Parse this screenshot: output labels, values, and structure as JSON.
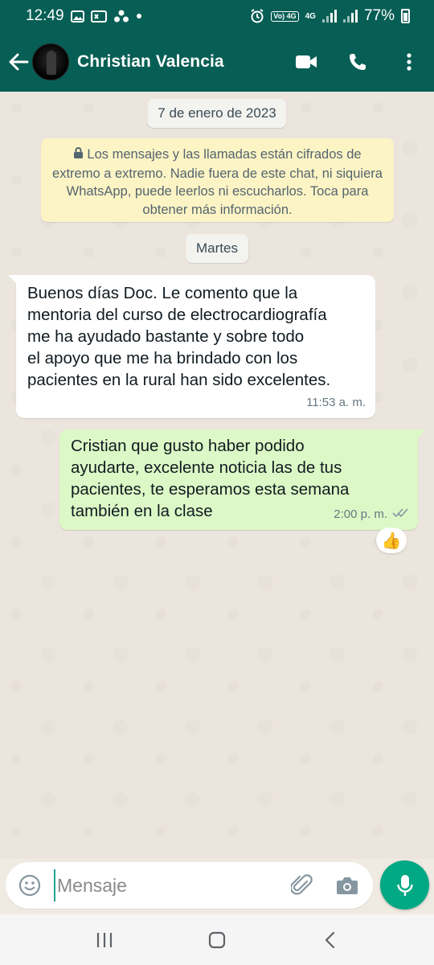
{
  "status_bar": {
    "time": "12:49",
    "battery": "77%",
    "network_badge": "Vo) 4G",
    "network_type": "4G",
    "icons": [
      "image-icon",
      "vpn-key-icon",
      "community-icon",
      "dot-icon",
      "alarm-icon",
      "volte-icon",
      "signal-icon",
      "signal-icon",
      "battery-icon"
    ]
  },
  "header": {
    "contact_name": "Christian Valencia",
    "icons": [
      "back-arrow-icon",
      "avatar",
      "video-call-icon",
      "phone-call-icon",
      "more-options-icon"
    ],
    "bg_color": "#075e54"
  },
  "chat": {
    "date_chip": "7 de enero de 2023",
    "encryption_notice": "Los mensajes y las llamadas están cifrados de extremo a extremo. Nadie fuera de este chat, ni siquiera WhatsApp, puede leerlos ni escucharlos. Toca para obtener más información.",
    "day_chip": "Martes",
    "messages": [
      {
        "direction": "incoming",
        "text": "Buenos días Doc. Le comento que la\nmentoria del curso de electrocardiografía\nme ha ayudado bastante y sobre todo\nel apoyo que me ha brindado con los\npacientes en la rural han sido excelentes.",
        "time": "11:53 a. m."
      },
      {
        "direction": "outgoing",
        "text": "Cristian  que gusto haber podido\nayudarte,  excelente noticia las de tus\npacientes,  te esperamos esta semana\ntambién  en la clase",
        "time": "2:00 p. m.",
        "status": "read-check-icon",
        "reaction": "👍"
      }
    ],
    "incoming_color": "#ffffff",
    "outgoing_color": "#dcf8c6"
  },
  "input_bar": {
    "placeholder": "Mensaje",
    "icons": [
      "emoji-icon",
      "attach-icon",
      "camera-icon",
      "mic-icon"
    ],
    "mic_color": "#00a884"
  },
  "nav_bar": {
    "icons": [
      "recent-apps-icon",
      "home-icon",
      "back-nav-icon"
    ]
  }
}
